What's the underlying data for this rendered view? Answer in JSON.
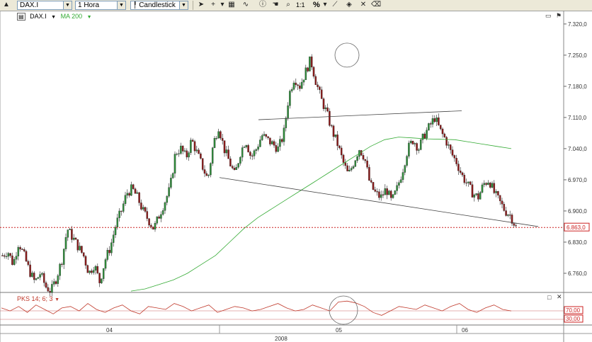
{
  "toolbar": {
    "symbol": "DAX.I",
    "timeframe": "1 Hora",
    "chart_type": "Candlestick",
    "zoom_one": "1:1",
    "percent": "%"
  },
  "legend": {
    "instrument": "DAX.I",
    "ma_label": "MA 200",
    "ma_color": "#33aa33"
  },
  "indicator": {
    "label": "PKS 14; 6; 3",
    "level_high": "70,00",
    "level_low": "30,00",
    "color": "#c0392b"
  },
  "price_marker": {
    "label": "6.863,0",
    "value": 6863,
    "color": "#cc2222"
  },
  "chart_data": {
    "type": "candlestick",
    "price_ticks": [
      "7.320,0",
      "7.250,0",
      "7.180,0",
      "7.110,0",
      "7.040,0",
      "6.970,0",
      "6.900,0",
      "6.830,0",
      "6.760,0"
    ],
    "price_tick_values": [
      7320,
      7250,
      7180,
      7110,
      7040,
      6970,
      6900,
      6830,
      6760
    ],
    "ylim": [
      6717,
      7350
    ],
    "x_month_labels": [
      "04",
      "05",
      "06"
    ],
    "x_year_label": "2008",
    "ma_series_name": "MA 200",
    "close_path": [
      6800,
      6810,
      6780,
      6830,
      6800,
      6765,
      6740,
      6760,
      6730,
      6720,
      6750,
      6790,
      6860,
      6840,
      6820,
      6800,
      6760,
      6780,
      6740,
      6790,
      6820,
      6870,
      6900,
      6940,
      6950,
      6930,
      6900,
      6880,
      6860,
      6890,
      6920,
      6950,
      7030,
      7040,
      7020,
      7060,
      7030,
      7000,
      6970,
      7050,
      7090,
      7040,
      7010,
      6980,
      7030,
      7060,
      7020,
      7040,
      7070,
      7060,
      7050,
      7040,
      7070,
      7160,
      7200,
      7180,
      7210,
      7240,
      7190,
      7150,
      7120,
      7080,
      7050,
      7010,
      6980,
      7010,
      7040,
      7020,
      6960,
      6940,
      6930,
      6950,
      6920,
      6950,
      6990,
      7040,
      7060,
      7040,
      7070,
      7090,
      7110,
      7080,
      7060,
      7030,
      7010,
      6980,
      6960,
      6940,
      6930,
      6960,
      6970,
      6940,
      6920,
      6900,
      6890,
      6863
    ],
    "ma_path": [
      6720,
      6725,
      6735,
      6745,
      6760,
      6780,
      6800,
      6830,
      6860,
      6885,
      6905,
      6925,
      6945,
      6965,
      6985,
      7005,
      7025,
      7045,
      7060,
      7066,
      7064,
      7062,
      7061,
      7060,
      7055,
      7050,
      7045,
      7040
    ],
    "trendlines": [
      {
        "name": "neckline-upper",
        "from": [
          7105
        ],
        "to": [
          7125
        ]
      },
      {
        "name": "support-lower",
        "from": [
          6975
        ],
        "to": [
          6865
        ]
      }
    ],
    "pks_path": [
      55,
      45,
      60,
      40,
      65,
      50,
      35,
      55,
      60,
      45,
      70,
      50,
      40,
      55,
      65,
      45,
      35,
      60,
      55,
      50,
      70,
      60,
      45,
      55,
      65,
      40,
      50,
      60,
      55,
      45,
      50,
      60,
      70,
      55,
      45,
      50,
      65,
      55,
      45,
      75,
      78,
      72,
      60,
      40,
      30,
      45,
      60,
      55,
      50,
      65,
      55,
      45,
      60,
      70,
      50,
      40,
      55,
      65,
      50,
      45
    ]
  }
}
